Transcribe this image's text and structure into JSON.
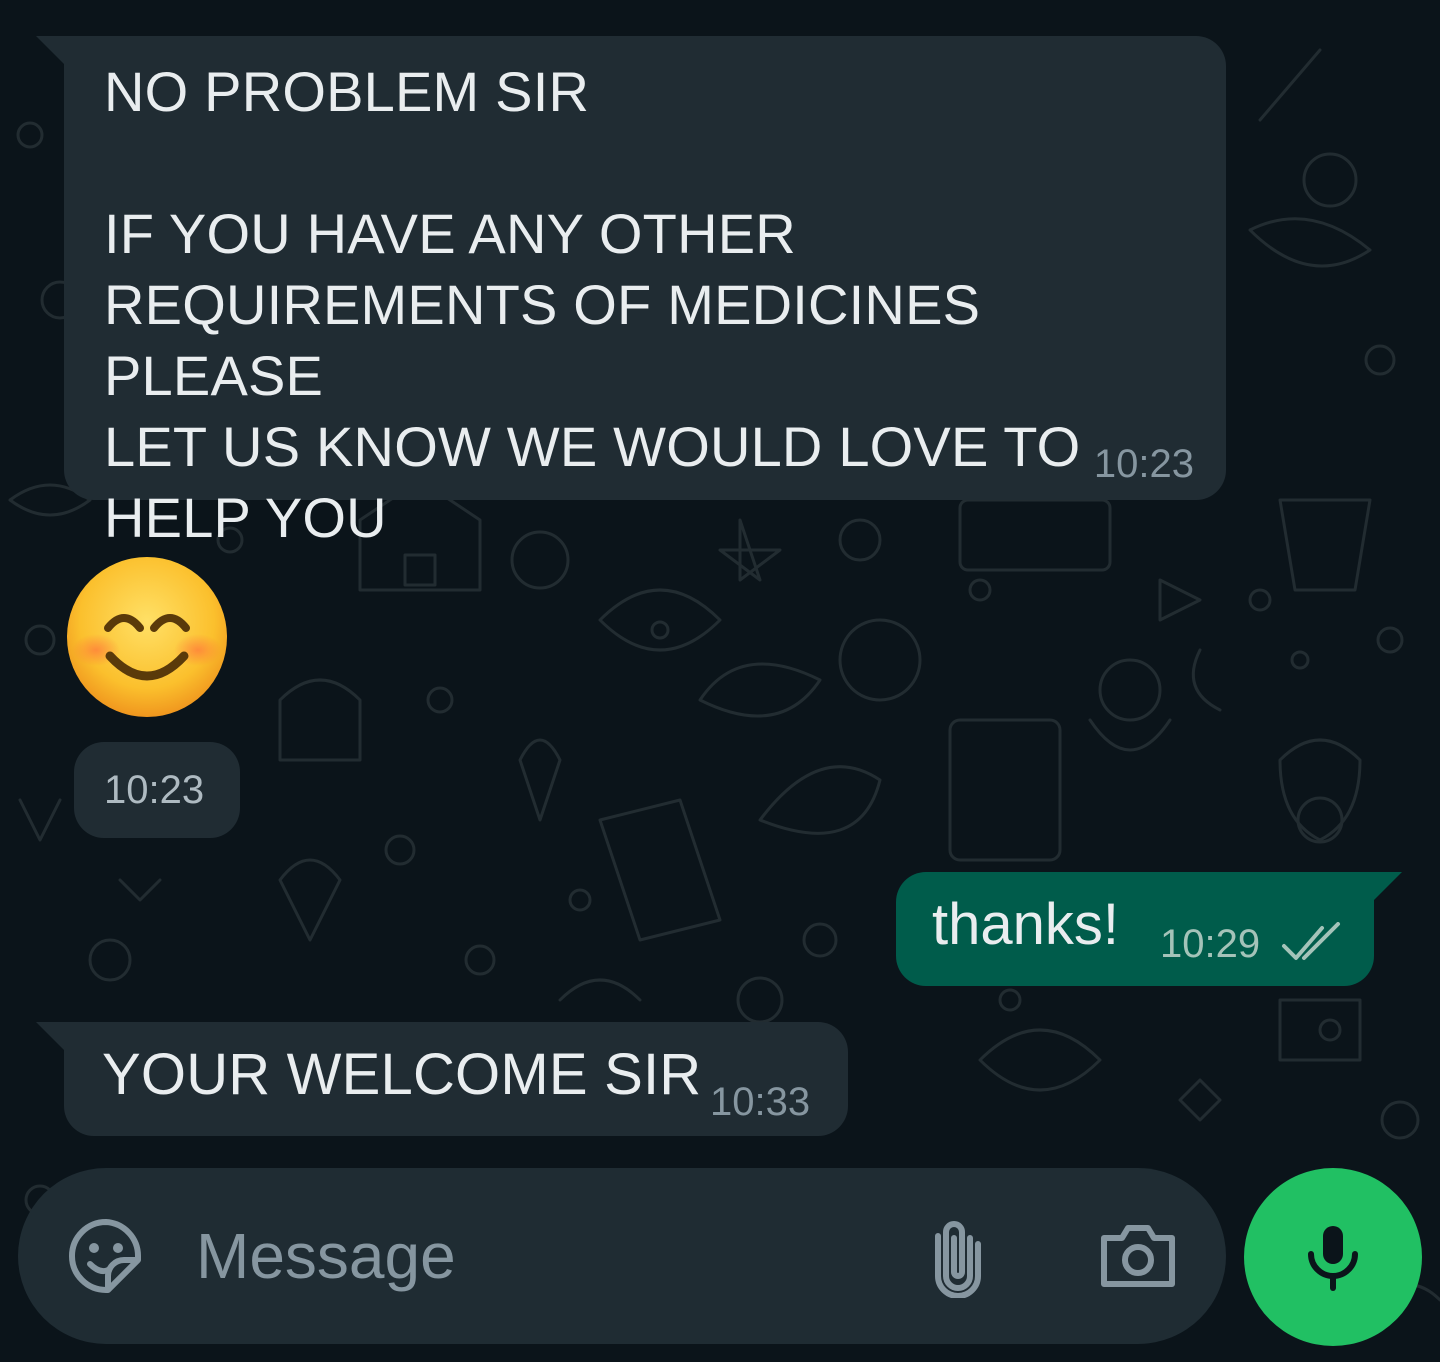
{
  "theme": {
    "background": "#0b141a",
    "incoming_bubble": "#202c33",
    "outgoing_bubble": "#005c4b",
    "text_primary": "#e9edef",
    "text_secondary": "#8696a0",
    "accent": "#21c063"
  },
  "messages": [
    {
      "direction": "incoming",
      "text": "NO PROBLEM SIR\n\nIF YOU HAVE ANY OTHER\nREQUIREMENTS OF MEDICINES PLEASE\nLET US KNOW WE WOULD LOVE TO\nHELP YOU",
      "time": "10:23"
    },
    {
      "direction": "incoming",
      "emoji": "😊",
      "time": "10:23"
    },
    {
      "direction": "outgoing",
      "text": "thanks!",
      "time": "10:29",
      "status": "read"
    },
    {
      "direction": "incoming",
      "text": "YOUR WELCOME SIR",
      "time": "10:33"
    }
  ],
  "composer": {
    "placeholder": "Message",
    "icons": [
      "sticker-icon",
      "attach-icon",
      "camera-icon",
      "mic-icon"
    ]
  }
}
